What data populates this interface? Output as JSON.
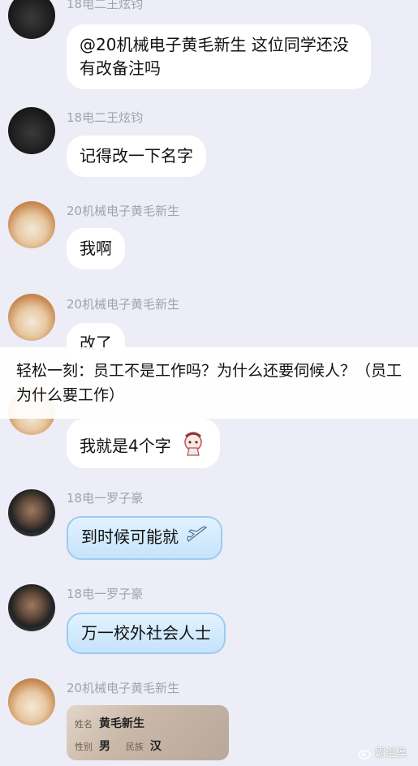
{
  "messages": [
    {
      "sender": "18电二王炫钧",
      "text": "@20机械电子黄毛新生 这位同学还没有改备注吗"
    },
    {
      "sender": "18电二王炫钧",
      "text": "记得改一下名字"
    },
    {
      "sender": "20机械电子黄毛新生",
      "text": "我啊"
    },
    {
      "sender": "20机械电子黄毛新生",
      "text": "改了"
    },
    {
      "sender": "",
      "text": "我就是4个字",
      "emoji_icon": "cartoon-sticker-icon"
    },
    {
      "sender": "18电一罗子豪",
      "text": "到时候可能就",
      "emoji_icon": "airplane-icon"
    },
    {
      "sender": "18电一罗子豪",
      "text": "万一校外社会人士"
    },
    {
      "sender": "20机械电子黄毛新生",
      "id_card": {
        "name_label": "姓名",
        "name": "黄毛新生",
        "gender_label": "性别",
        "gender": "男",
        "ethnicity_label": "民族",
        "ethnicity": "汉"
      }
    }
  ],
  "overlay_caption": "轻松一刻：员工不是工作吗？为什么还要伺候人？（员工为什么要工作）",
  "watermark": "霸温侯",
  "colors": {
    "background": "#ecedf6",
    "bubble": "#ffffff",
    "blue_bubble": "#c5e3fb",
    "name_text": "#a1a3ad"
  }
}
